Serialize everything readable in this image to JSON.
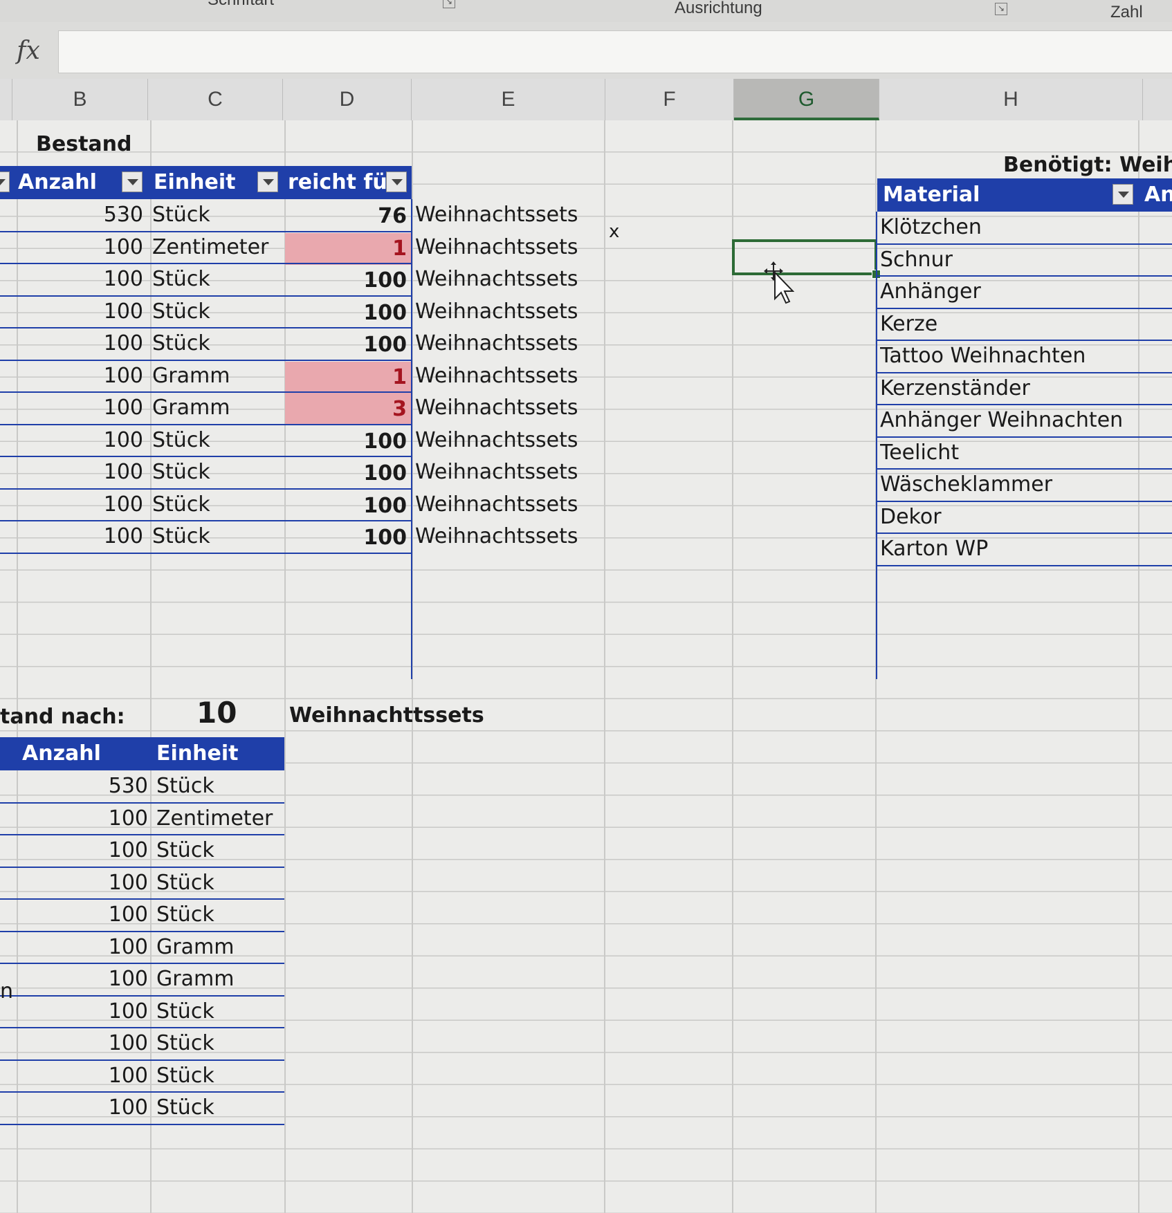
{
  "ribbon": {
    "group_left": "Schriftart",
    "group_center": "Ausrichtung",
    "group_right": "Zahl"
  },
  "formula_bar": {
    "fx_label": "fx",
    "value": ""
  },
  "columns": [
    "B",
    "C",
    "D",
    "E",
    "F",
    "G",
    "H"
  ],
  "selected_column": "G",
  "bestand": {
    "title": "Bestand",
    "headers": {
      "anzahl": "Anzahl",
      "einheit": "Einheit",
      "reicht_fuer": "reicht für"
    },
    "rows": [
      {
        "anzahl": "530",
        "einheit": "Stück",
        "reicht": "76",
        "text": "Weihnachtssets",
        "low": false
      },
      {
        "anzahl": "100",
        "einheit": "Zentimeter",
        "reicht": "1",
        "text": "Weihnachtssets",
        "low": true
      },
      {
        "anzahl": "100",
        "einheit": "Stück",
        "reicht": "100",
        "text": "Weihnachtssets",
        "low": false
      },
      {
        "anzahl": "100",
        "einheit": "Stück",
        "reicht": "100",
        "text": "Weihnachtssets",
        "low": false
      },
      {
        "anzahl": "100",
        "einheit": "Stück",
        "reicht": "100",
        "text": "Weihnachtssets",
        "low": false
      },
      {
        "anzahl": "100",
        "einheit": "Gramm",
        "reicht": "1",
        "text": "Weihnachtssets",
        "low": true
      },
      {
        "anzahl": "100",
        "einheit": "Gramm",
        "reicht": "3",
        "text": "Weihnachtssets",
        "low": true
      },
      {
        "anzahl": "100",
        "einheit": "Stück",
        "reicht": "100",
        "text": "Weihnachtssets",
        "low": false
      },
      {
        "anzahl": "100",
        "einheit": "Stück",
        "reicht": "100",
        "text": "Weihnachtssets",
        "low": false
      },
      {
        "anzahl": "100",
        "einheit": "Stück",
        "reicht": "100",
        "text": "Weihnachtssets",
        "low": false
      },
      {
        "anzahl": "100",
        "einheit": "Stück",
        "reicht": "100",
        "text": "Weihnachtssets",
        "low": false
      }
    ],
    "marker": "x"
  },
  "benoetigt": {
    "title": "Benötigt: Weihn",
    "headers": {
      "material": "Material",
      "anzahl": "An"
    },
    "rows": [
      "Klötzchen",
      "Schnur",
      "Anhänger",
      "Kerze",
      "Tattoo Weihnachten",
      "Kerzenständer",
      "Anhänger Weihnachten",
      "Teelicht",
      "Wäscheklammer",
      "Dekor",
      "Karton WP"
    ]
  },
  "nach": {
    "label": "tand nach:",
    "count": "10",
    "unit": "Weihnachttssets",
    "row_edge_mark": "n",
    "headers": {
      "anzahl": "Anzahl",
      "einheit": "Einheit"
    },
    "rows": [
      {
        "anzahl": "530",
        "einheit": "Stück"
      },
      {
        "anzahl": "100",
        "einheit": "Zentimeter"
      },
      {
        "anzahl": "100",
        "einheit": "Stück"
      },
      {
        "anzahl": "100",
        "einheit": "Stück"
      },
      {
        "anzahl": "100",
        "einheit": "Stück"
      },
      {
        "anzahl": "100",
        "einheit": "Gramm"
      },
      {
        "anzahl": "100",
        "einheit": "Gramm"
      },
      {
        "anzahl": "100",
        "einheit": "Stück"
      },
      {
        "anzahl": "100",
        "einheit": "Stück"
      },
      {
        "anzahl": "100",
        "einheit": "Stück"
      },
      {
        "anzahl": "100",
        "einheit": "Stück"
      }
    ]
  },
  "colors": {
    "table_header": "#1f3fa9",
    "low_stock_fill": "#e9a8ae",
    "low_stock_text": "#a4141f",
    "selection": "#2d6b36"
  }
}
